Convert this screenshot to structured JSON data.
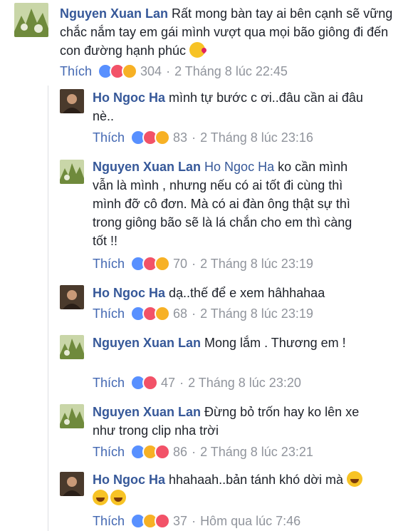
{
  "comments": [
    {
      "author": "Nguyen Xuan Lan",
      "mention": "",
      "text": "Rất mong bàn tay ai bên cạnh sẽ vững chắc nắm tay em gái mình vượt qua mọi bão giông đi đến con đường hạnh phúc",
      "emoji": [
        "kiss-emoji"
      ],
      "like_label": "Thích",
      "reactions": [
        "like",
        "love",
        "haha"
      ],
      "count": "304",
      "timestamp": "2 Tháng 8 lúc 22:45"
    },
    {
      "author": "Ho Ngoc Ha",
      "mention": "",
      "text": "mình tự bước c ơi..đâu cần ai đâu nè..",
      "like_label": "Thích",
      "reactions": [
        "like",
        "love",
        "haha"
      ],
      "count": "83",
      "timestamp": "2 Tháng 8 lúc 23:16"
    },
    {
      "author": "Nguyen Xuan Lan",
      "mention": "Ho Ngoc Ha",
      "text": "ko cần mình vẫn là mình , nhưng nếu có ai tốt đi cùng thì mình đỡ cô đơn. Mà có ai đàn ông thật sự thì trong giông bão sẽ là lá chắn cho em thì càng tốt !!",
      "like_label": "Thích",
      "reactions": [
        "like",
        "love",
        "haha"
      ],
      "count": "70",
      "timestamp": "2 Tháng 8 lúc 23:19"
    },
    {
      "author": "Ho Ngoc Ha",
      "mention": "",
      "text": "dạ..thế để e xem hâhhahaa",
      "like_label": "Thích",
      "reactions": [
        "like",
        "love",
        "wow"
      ],
      "count": "68",
      "timestamp": "2 Tháng 8 lúc 23:19"
    },
    {
      "author": "Nguyen Xuan Lan",
      "mention": "",
      "text": "Mong lắm . Thương em !",
      "like_label": "Thích",
      "reactions": [
        "like",
        "love"
      ],
      "count": "47",
      "timestamp": "2 Tháng 8 lúc 23:20"
    },
    {
      "author": "Nguyen Xuan Lan",
      "mention": "",
      "text": "Đừng bỏ trốn hay ko lên xe như trong clip nha trời",
      "like_label": "Thích",
      "reactions": [
        "like",
        "haha",
        "love"
      ],
      "count": "86",
      "timestamp": "2 Tháng 8 lúc 23:21"
    },
    {
      "author": "Ho Ngoc Ha",
      "mention": "",
      "text": "hhahaah..bản tánh khó dời mà",
      "emoji": [
        "laugh-emoji",
        "laugh-emoji",
        "laugh-emoji"
      ],
      "like_label": "Thích",
      "reactions": [
        "like",
        "haha",
        "love"
      ],
      "count": "37",
      "timestamp": "Hôm qua lúc 7:46"
    }
  ],
  "colors": {
    "author": "#365899",
    "like_link": "#4267b2",
    "meta": "#90949c",
    "like_reaction": "#5890ff",
    "love_reaction": "#f25268",
    "haha_reaction": "#f7b125"
  }
}
